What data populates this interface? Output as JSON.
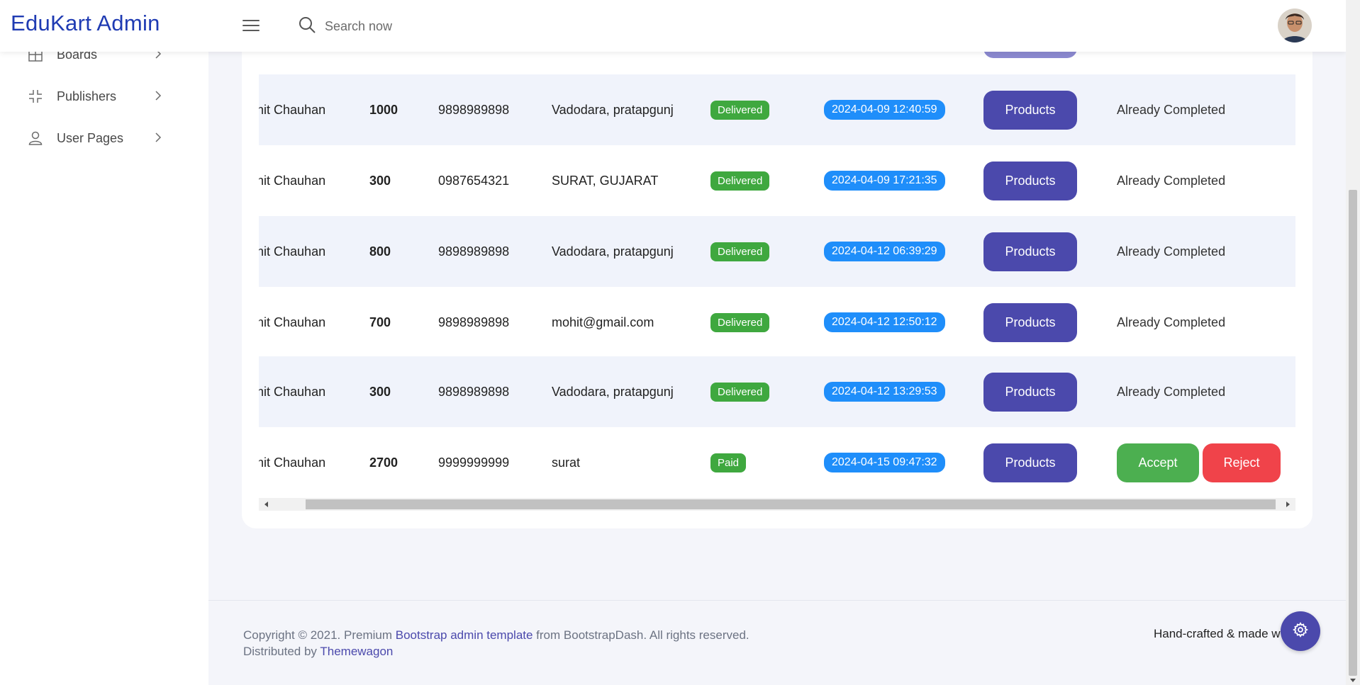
{
  "header": {
    "brand": "EduKart Admin",
    "search_placeholder": "Search now",
    "menu_icon": "hamburger-icon",
    "search_icon": "search-icon"
  },
  "sidebar": {
    "items": [
      {
        "label": "Boards",
        "icon": "grid-icon"
      },
      {
        "label": "Publishers",
        "icon": "collapse-icon"
      },
      {
        "label": "User Pages",
        "icon": "user-icon"
      }
    ]
  },
  "orders": {
    "rows": [
      {
        "name": "ohit Chauhan",
        "amount": "1000",
        "phone": "9898989898",
        "address": "Vadodara, pratapgunj",
        "status": "Delivered",
        "date": "2024-04-09 12:40:59",
        "products_label": "Products",
        "action": "Already Completed"
      },
      {
        "name": "ohit Chauhan",
        "amount": "300",
        "phone": "0987654321",
        "address": "SURAT, GUJARAT",
        "status": "Delivered",
        "date": "2024-04-09 17:21:35",
        "products_label": "Products",
        "action": "Already Completed"
      },
      {
        "name": "ohit Chauhan",
        "amount": "800",
        "phone": "9898989898",
        "address": "Vadodara, pratapgunj",
        "status": "Delivered",
        "date": "2024-04-12 06:39:29",
        "products_label": "Products",
        "action": "Already Completed"
      },
      {
        "name": "ohit Chauhan",
        "amount": "700",
        "phone": "9898989898",
        "address": "mohit@gmail.com",
        "status": "Delivered",
        "date": "2024-04-12 12:50:12",
        "products_label": "Products",
        "action": "Already Completed"
      },
      {
        "name": "ohit Chauhan",
        "amount": "300",
        "phone": "9898989898",
        "address": "Vadodara, pratapgunj",
        "status": "Delivered",
        "date": "2024-04-12 13:29:53",
        "products_label": "Products",
        "action": "Already Completed"
      },
      {
        "name": "ohit Chauhan",
        "amount": "2700",
        "phone": "9999999999",
        "address": "surat",
        "status": "Paid",
        "date": "2024-04-15 09:47:32",
        "products_label": "Products",
        "accept_label": "Accept",
        "reject_label": "Reject"
      }
    ]
  },
  "footer": {
    "copy_prefix": "Copyright © 2021. Premium ",
    "copy_link": "Bootstrap admin template",
    "copy_suffix": " from BootstrapDash. All rights reserved.",
    "distributed_prefix": "Distributed by ",
    "distributed_link": "Themewagon",
    "handcrafted": "Hand-crafted & made w"
  },
  "colors": {
    "brand": "#1f3bb3",
    "primary_button": "#4b49ac",
    "delivered_badge": "#3fa83f",
    "date_badge": "#1f8efa",
    "accept": "#4caf50",
    "reject": "#f0434a"
  }
}
